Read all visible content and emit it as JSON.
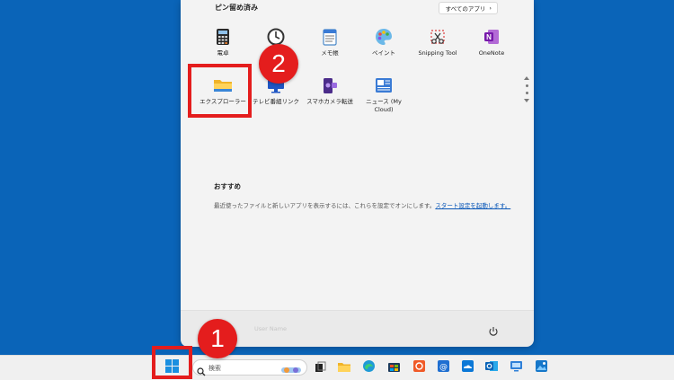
{
  "start_menu": {
    "pinned_title": "ピン留め済み",
    "all_apps_label": "すべてのアプリ",
    "all_apps_chevron": "›",
    "pinned_apps": [
      {
        "label": "電卓",
        "icon": "calculator-icon"
      },
      {
        "label": "",
        "icon": "clock-icon"
      },
      {
        "label": "メモ帳",
        "icon": "notepad-icon"
      },
      {
        "label": "ペイント",
        "icon": "paint-icon"
      },
      {
        "label": "Snipping Tool",
        "icon": "snipping-tool-icon"
      },
      {
        "label": "OneNote",
        "icon": "onenote-icon"
      },
      {
        "label": "エクスプローラー",
        "icon": "file-explorer-icon"
      },
      {
        "label": "テレビ番組リンク",
        "icon": "tv-icon"
      },
      {
        "label": "スマホカメラ転送",
        "icon": "phone-camera-icon"
      },
      {
        "label": "ニュース (My Cloud)",
        "icon": "news-icon"
      }
    ],
    "recommended_title": "おすすめ",
    "recommended_text": "最近使ったファイルと新しいアプリを表示するには、これらを設定でオンにします。",
    "recommended_link": "スタート設定を起動します。",
    "user_name": "User Name"
  },
  "taskbar": {
    "search_placeholder": "検索",
    "apps": [
      "task-view-icon",
      "file-explorer-icon",
      "edge-icon",
      "store-icon",
      "app-icon",
      "mail-icon",
      "onedrive-icon",
      "outlook-icon",
      "remote-desktop-icon",
      "photos-icon"
    ]
  },
  "callouts": [
    {
      "number": "1"
    },
    {
      "number": "2"
    }
  ],
  "colors": {
    "desktop": "#0a64b8",
    "callout": "#e41d1d",
    "link": "#0a57b8"
  }
}
